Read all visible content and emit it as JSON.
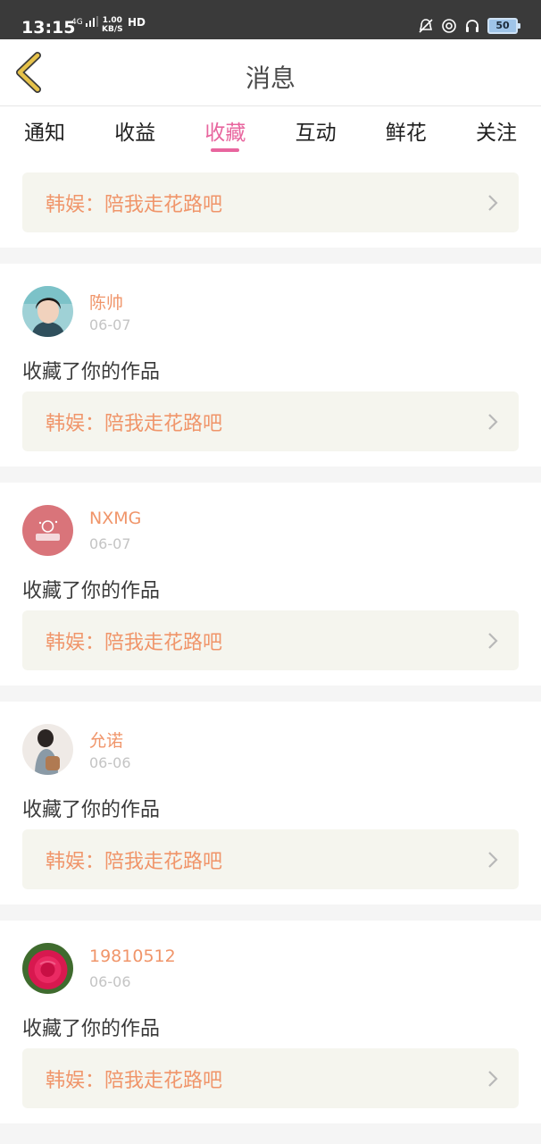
{
  "status_bar": {
    "time": "13:15",
    "network": "4G",
    "speed_value": "1.00",
    "speed_unit": "KB/S",
    "hd": "HD",
    "battery": "50"
  },
  "header": {
    "title": "消息",
    "back_icon": "chevron-left-icon"
  },
  "tabs": [
    {
      "label": "通知",
      "active": false
    },
    {
      "label": "收益",
      "active": false
    },
    {
      "label": "收藏",
      "active": true
    },
    {
      "label": "互动",
      "active": false
    },
    {
      "label": "鲜花",
      "active": false
    },
    {
      "label": "关注",
      "active": false
    }
  ],
  "top_item": {
    "work_title": "韩娱：陪我走花路吧"
  },
  "items": [
    {
      "username": "陈帅",
      "date": "06-07",
      "action": "收藏了你的作品",
      "work_title": "韩娱：陪我走花路吧"
    },
    {
      "username": "NXMG",
      "date": "06-07",
      "action": "收藏了你的作品",
      "work_title": "韩娱：陪我走花路吧"
    },
    {
      "username": "允诺",
      "date": "06-06",
      "action": "收藏了你的作品",
      "work_title": "韩娱：陪我走花路吧"
    },
    {
      "username": "19810512",
      "date": "06-06",
      "action": "收藏了你的作品",
      "work_title": "韩娱：陪我走花路吧"
    }
  ],
  "colors": {
    "accent": "#e8659e",
    "username": "#f0956a",
    "link_bg": "#f5f5ee",
    "back_icon": "#e6c24a"
  }
}
